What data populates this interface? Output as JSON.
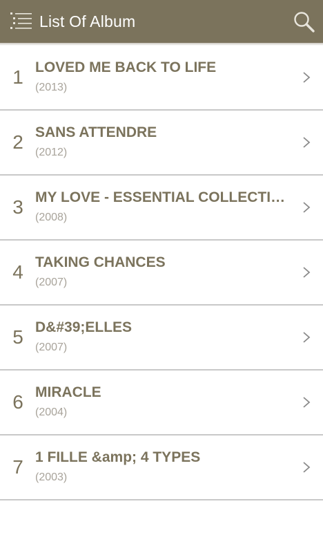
{
  "header": {
    "title": "List Of Album",
    "menu_icon": "list-menu-icon",
    "search_icon": "search-icon"
  },
  "colors": {
    "toolbar": "#7b735c",
    "accent_text": "#7b735c",
    "secondary_text": "#a8a39a",
    "divider": "#c8c8c8"
  },
  "albums": [
    {
      "number": "1",
      "title": "LOVED ME BACK TO LIFE",
      "year": "(2013)"
    },
    {
      "number": "2",
      "title": "SANS ATTENDRE",
      "year": "(2012)"
    },
    {
      "number": "3",
      "title": "MY LOVE - ESSENTIAL COLLECTION",
      "year": "(2008)"
    },
    {
      "number": "4",
      "title": "TAKING CHANCES",
      "year": "(2007)"
    },
    {
      "number": "5",
      "title": "D&#39;ELLES",
      "year": "(2007)"
    },
    {
      "number": "6",
      "title": "MIRACLE",
      "year": "(2004)"
    },
    {
      "number": "7",
      "title": "1 FILLE &amp; 4 TYPES",
      "year": "(2003)"
    }
  ]
}
